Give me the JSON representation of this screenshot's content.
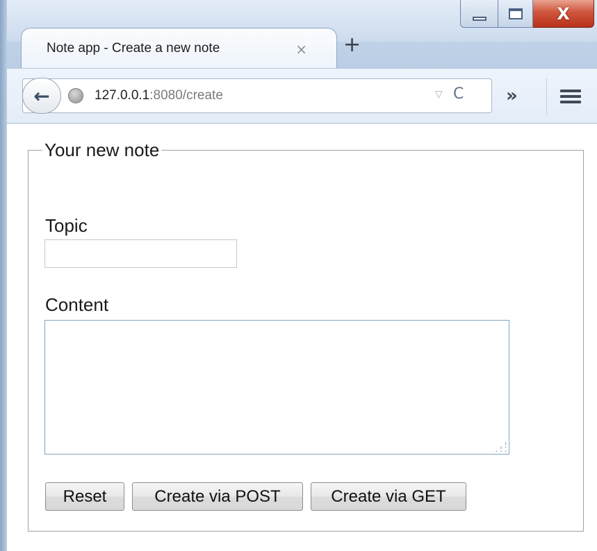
{
  "window": {
    "minimize_label": "",
    "maximize_label": "",
    "close_glyph": "X"
  },
  "tab": {
    "title": "Note app - Create a new note",
    "close_glyph": "×",
    "new_tab_glyph": "+"
  },
  "navbar": {
    "back_glyph": "←",
    "url_host": "127.0.0.1",
    "url_rest": ":8080/create",
    "dropdown_glyph": "▽",
    "reload_glyph": "C",
    "overflow_glyph": "»",
    "icons": {
      "back": "back-arrow-icon",
      "site": "globe-icon",
      "reload": "reload-icon",
      "menu": "hamburger-menu-icon"
    }
  },
  "form": {
    "legend": "Your new note",
    "topic_label": "Topic",
    "topic_value": "",
    "topic_placeholder": "",
    "content_label": "Content",
    "content_value": "",
    "content_placeholder": "",
    "buttons": {
      "reset": "Reset",
      "post": "Create via POST",
      "get": "Create via GET"
    }
  },
  "colors": {
    "frame": "#b9cde4",
    "close_button": "#cf553c",
    "textarea_border": "#7fa6c4"
  }
}
